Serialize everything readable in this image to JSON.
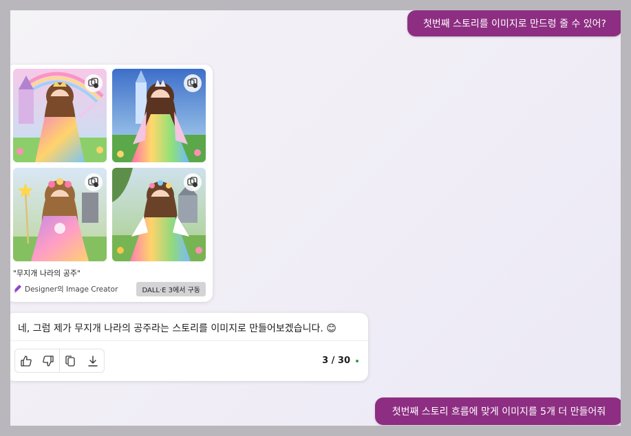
{
  "messages": {
    "user_top": "첫번째 스토리를 이미지로 만드렁 줄 수 있어?",
    "user_bottom": "첫번째 스토리 흐름에 맞게 이미지를 5개 더 만들어줘"
  },
  "image_card": {
    "caption": "\"무지개 나라의 공주\"",
    "source": "Designer의 Image Creator",
    "badge": "DALL·E 3에서 구동"
  },
  "reply": {
    "text": "네, 그럼 제가 무지개 나라의 공주라는 스토리를 이미지로 만들어보겠습니다. 😊",
    "counter": "3 / 30"
  },
  "colors": {
    "user_bubble": "#8d2e82",
    "status_dot": "#2e9b45"
  }
}
